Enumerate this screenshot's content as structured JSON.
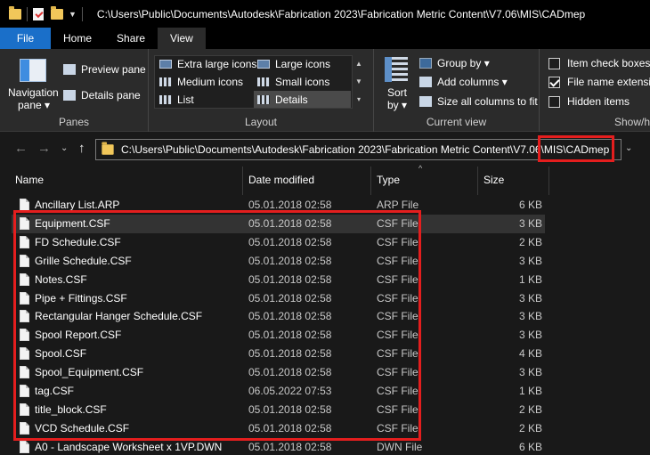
{
  "window": {
    "title": "C:\\Users\\Public\\Documents\\Autodesk\\Fabrication 2023\\Fabrication Metric Content\\V7.06\\MIS\\CADmep"
  },
  "tabs": [
    {
      "label": "File"
    },
    {
      "label": "Home"
    },
    {
      "label": "Share"
    },
    {
      "label": "View"
    }
  ],
  "ribbon": {
    "panes": {
      "label": "Panes",
      "navigation_pane": "Navigation",
      "navigation_pane_sub": "pane ▾",
      "preview_pane": "Preview pane",
      "details_pane": "Details pane"
    },
    "layout": {
      "label": "Layout",
      "extra_large_icons": "Extra large icons",
      "large_icons": "Large icons",
      "medium_icons": "Medium icons",
      "small_icons": "Small icons",
      "list": "List",
      "details": "Details"
    },
    "current_view": {
      "label": "Current view",
      "sort_by": "Sort",
      "sort_by_sub": "by ▾",
      "group_by": "Group by ▾",
      "add_columns": "Add columns ▾",
      "size_all_columns": "Size all columns to fit"
    },
    "show_hide": {
      "label": "Show/h",
      "item_check_boxes": "Item check boxes",
      "file_name_extensions": "File name extensio",
      "hidden_items": "Hidden items",
      "item_check_boxes_checked": false,
      "file_name_extensions_checked": true,
      "hidden_items_checked": false
    }
  },
  "address": {
    "path": "C:\\Users\\Public\\Documents\\Autodesk\\Fabrication 2023\\Fabrication Metric Content\\V7.06\\MIS\\CADmep"
  },
  "columns": {
    "name": "Name",
    "date_modified": "Date modified",
    "type": "Type",
    "size": "Size"
  },
  "files": [
    {
      "name": "Ancillary List.ARP",
      "date": "05.01.2018 02:58",
      "type": "ARP File",
      "size": "6 KB"
    },
    {
      "name": "Equipment.CSF",
      "date": "05.01.2018 02:58",
      "type": "CSF File",
      "size": "3 KB"
    },
    {
      "name": "FD Schedule.CSF",
      "date": "05.01.2018 02:58",
      "type": "CSF File",
      "size": "2 KB"
    },
    {
      "name": "Grille Schedule.CSF",
      "date": "05.01.2018 02:58",
      "type": "CSF File",
      "size": "3 KB"
    },
    {
      "name": "Notes.CSF",
      "date": "05.01.2018 02:58",
      "type": "CSF File",
      "size": "1 KB"
    },
    {
      "name": "Pipe + Fittings.CSF",
      "date": "05.01.2018 02:58",
      "type": "CSF File",
      "size": "3 KB"
    },
    {
      "name": "Rectangular Hanger Schedule.CSF",
      "date": "05.01.2018 02:58",
      "type": "CSF File",
      "size": "3 KB"
    },
    {
      "name": "Spool Report.CSF",
      "date": "05.01.2018 02:58",
      "type": "CSF File",
      "size": "3 KB"
    },
    {
      "name": "Spool.CSF",
      "date": "05.01.2018 02:58",
      "type": "CSF File",
      "size": "4 KB"
    },
    {
      "name": "Spool_Equipment.CSF",
      "date": "05.01.2018 02:58",
      "type": "CSF File",
      "size": "3 KB"
    },
    {
      "name": "tag.CSF",
      "date": "06.05.2022 07:53",
      "type": "CSF File",
      "size": "1 KB"
    },
    {
      "name": "title_block.CSF",
      "date": "05.01.2018 02:58",
      "type": "CSF File",
      "size": "2 KB"
    },
    {
      "name": "VCD Schedule.CSF",
      "date": "05.01.2018 02:58",
      "type": "CSF File",
      "size": "2 KB"
    },
    {
      "name": "A0 - Landscape Worksheet x 1VP.DWN",
      "date": "05.01.2018 02:58",
      "type": "DWN File",
      "size": "6 KB"
    }
  ],
  "colors": {
    "accent": "#1a6fc9",
    "highlight": "#e41e1e",
    "background": "#191919"
  }
}
